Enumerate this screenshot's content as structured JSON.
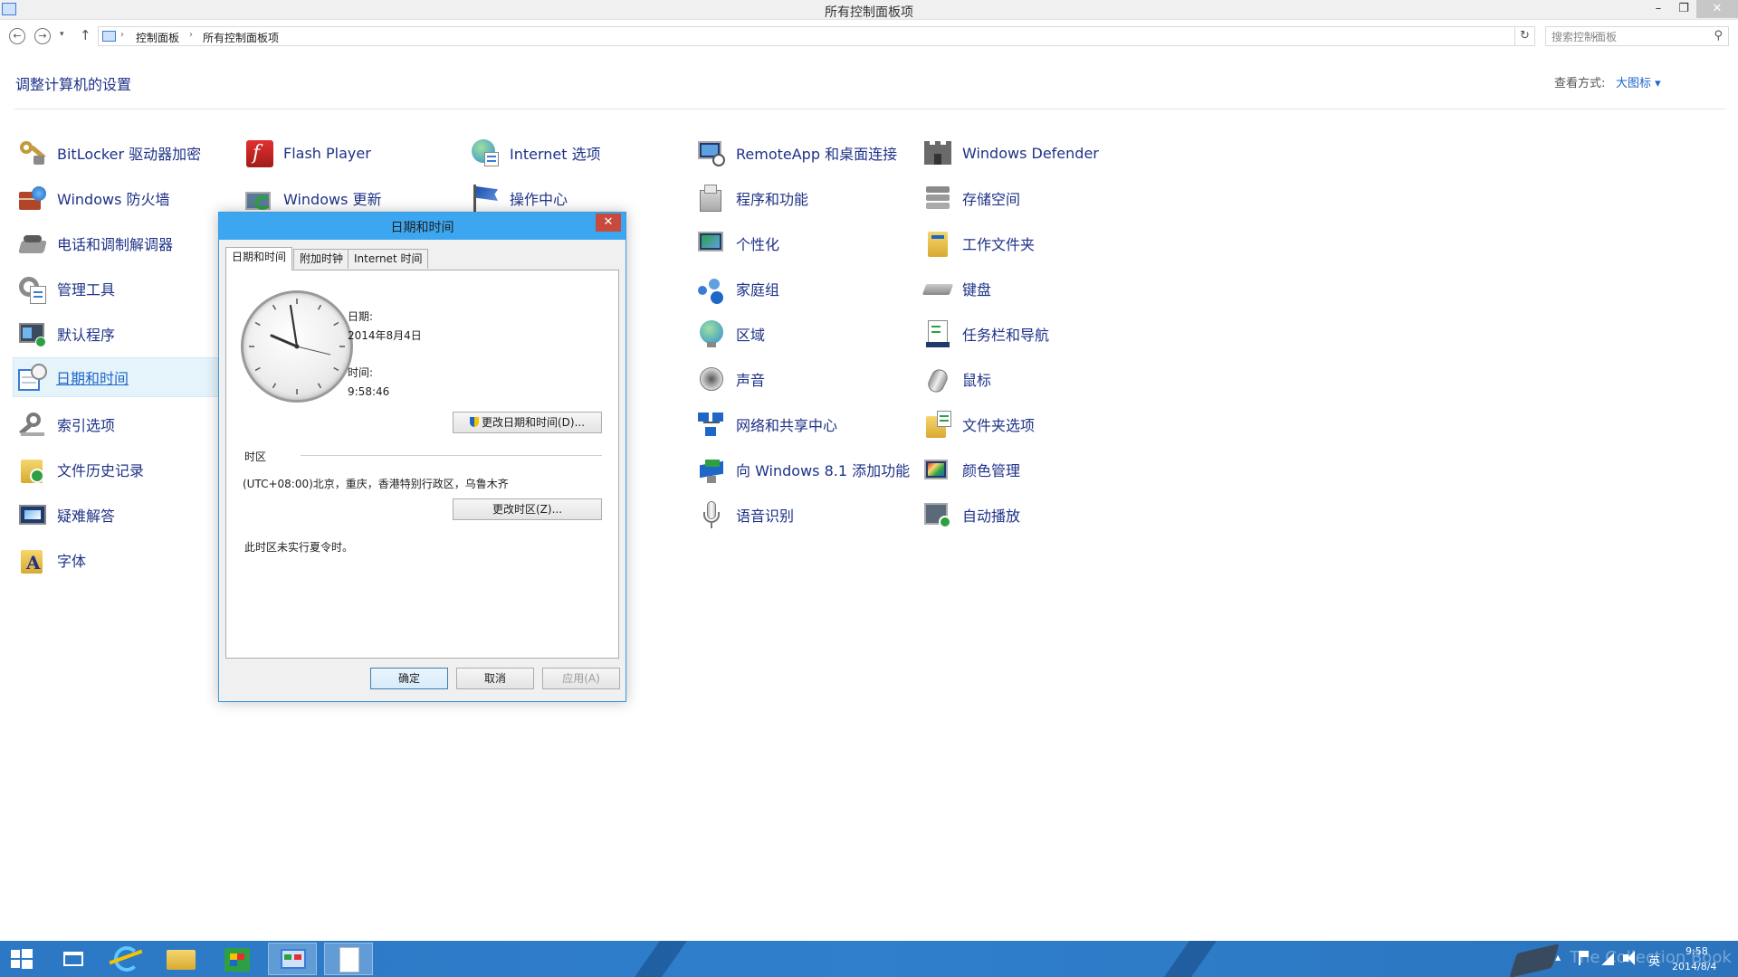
{
  "window": {
    "title": "所有控制面板项",
    "min_glyph": "–",
    "max_glyph": "❐",
    "close_glyph": "✕"
  },
  "address": {
    "back_glyph": "←",
    "forward_glyph": "→",
    "recent_glyph": "▾",
    "up_glyph": "↑",
    "breadcrumb": [
      "控制面板",
      "所有控制面板项"
    ],
    "sep_glyph": "›",
    "dropdown_glyph": "⌄",
    "refresh_glyph": "↻",
    "search_placeholder": "搜索控制面板",
    "search_glyph": "⚲"
  },
  "header": {
    "title": "调整计算机的设置",
    "view_by_label": "查看方式:",
    "view_by_value": "大图标 ▾"
  },
  "items": {
    "bitlocker": "BitLocker 驱动器加密",
    "firewall": "Windows 防火墙",
    "phone_modem": "电话和调制解调器",
    "admin_tools": "管理工具",
    "default_programs": "默认程序",
    "date_time": "日期和时间",
    "indexing": "索引选项",
    "file_history": "文件历史记录",
    "troubleshooting": "疑难解答",
    "fonts": "字体",
    "flash_player": "Flash Player",
    "windows_update": "Windows 更新",
    "internet_options": "Internet 选项",
    "action_center": "操作中心",
    "remoteapp": "RemoteApp 和桌面连接",
    "programs_features": "程序和功能",
    "personalization": "个性化",
    "homegroup": "家庭组",
    "region": "区域",
    "sound": "声音",
    "network_sharing": "网络和共享中心",
    "add_features": "向 Windows 8.1 添加功能",
    "speech": "语音识别",
    "defender": "Windows Defender",
    "storage_spaces": "存储空间",
    "work_folders": "工作文件夹",
    "keyboard": "键盘",
    "taskbar_nav": "任务栏和导航",
    "mouse": "鼠标",
    "folder_options": "文件夹选项",
    "color_management": "颜色管理",
    "autoplay": "自动播放"
  },
  "dialog": {
    "title": "日期和时间",
    "close_glyph": "✕",
    "tabs": [
      "日期和时间",
      "附加时钟",
      "Internet 时间"
    ],
    "date_label": "日期:",
    "date_value": "2014年8月4日",
    "time_label": "时间:",
    "time_value": "9:58:46",
    "change_datetime_button": "更改日期和时间(D)...",
    "timezone_label": "时区",
    "timezone_value": "(UTC+08:00)北京，重庆，香港特别行政区，乌鲁木齐",
    "change_timezone_button": "更改时区(Z)...",
    "dst_note": "此时区未实行夏令时。",
    "ok": "确定",
    "cancel": "取消",
    "apply": "应用(A)"
  },
  "taskbar": {
    "tray_time": "9:58",
    "tray_date": "2014/8/4",
    "ime": "英",
    "tray_up_glyph": "▲",
    "watermark": "The Collection Book"
  }
}
